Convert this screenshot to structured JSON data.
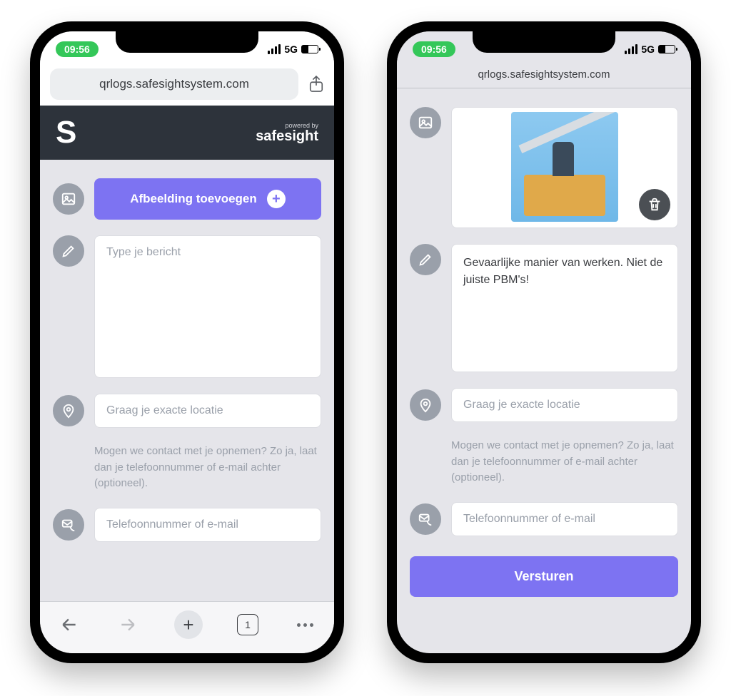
{
  "status": {
    "time": "09:56",
    "network": "5G"
  },
  "url": "qrlogs.safesightsystem.com",
  "header": {
    "logo": "S",
    "powered_by_small": "powered by",
    "powered_by_brand": "safesight"
  },
  "left": {
    "add_image_label": "Afbeelding toevoegen",
    "message_placeholder": "Type je bericht",
    "location_placeholder": "Graag je exacte locatie",
    "contact_hint": "Mogen we contact met je opnemen? Zo ja, laat dan je telefoonnummer of e-mail achter (optioneel).",
    "contact_placeholder": "Telefoonnummer of e-mail",
    "tab_count": "1"
  },
  "right": {
    "message_value": "Gevaarlijke manier van werken. Niet de juiste PBM's!",
    "location_placeholder": "Graag je exacte locatie",
    "contact_hint": "Mogen we contact met je opnemen? Zo ja, laat dan je telefoonnummer of e-mail achter (optioneel).",
    "contact_placeholder": "Telefoonnummer of e-mail",
    "submit_label": "Versturen"
  }
}
